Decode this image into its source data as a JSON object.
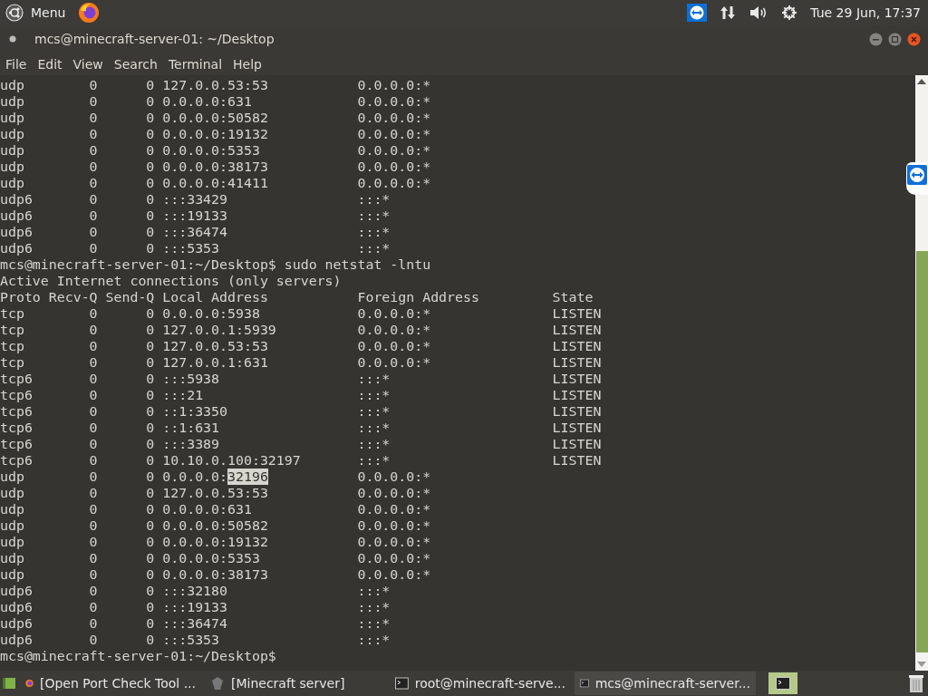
{
  "top_panel": {
    "menu_label": "Menu",
    "clock": "Tue 29 Jun, 17:37"
  },
  "window": {
    "title": "mcs@minecraft-server-01: ~/Desktop"
  },
  "menu": [
    "File",
    "Edit",
    "View",
    "Search",
    "Terminal",
    "Help"
  ],
  "terminal_lines": [
    "udp        0      0 127.0.0.53:53           0.0.0.0:*",
    "udp        0      0 0.0.0.0:631             0.0.0.0:*",
    "udp        0      0 0.0.0.0:50582           0.0.0.0:*",
    "udp        0      0 0.0.0.0:19132           0.0.0.0:*",
    "udp        0      0 0.0.0.0:5353            0.0.0.0:*",
    "udp        0      0 0.0.0.0:38173           0.0.0.0:*",
    "udp        0      0 0.0.0.0:41411           0.0.0.0:*",
    "udp6       0      0 :::33429                :::*",
    "udp6       0      0 :::19133                :::*",
    "udp6       0      0 :::36474                :::*",
    "udp6       0      0 :::5353                 :::*",
    "mcs@minecraft-server-01:~/Desktop$ sudo netstat -lntu",
    "Active Internet connections (only servers)",
    "Proto Recv-Q Send-Q Local Address           Foreign Address         State",
    "tcp        0      0 0.0.0.0:5938            0.0.0.0:*               LISTEN",
    "tcp        0      0 127.0.0.1:5939          0.0.0.0:*               LISTEN",
    "tcp        0      0 127.0.0.53:53           0.0.0.0:*               LISTEN",
    "tcp        0      0 127.0.0.1:631           0.0.0.0:*               LISTEN",
    "tcp6       0      0 :::5938                 :::*                    LISTEN",
    "tcp6       0      0 :::21                   :::*                    LISTEN",
    "tcp6       0      0 ::1:3350                :::*                    LISTEN",
    "tcp6       0      0 ::1:631                 :::*                    LISTEN",
    "tcp6       0      0 :::3389                 :::*                    LISTEN",
    "tcp6       0      0 10.10.0.100:32197       :::*                    LISTEN",
    [
      {
        "text": "udp        0      0 0.0.0.0:",
        "selected": false
      },
      {
        "text": "32196",
        "selected": true
      },
      {
        "text": "           0.0.0.0:*",
        "selected": false
      }
    ],
    "udp        0      0 127.0.0.53:53           0.0.0.0:*",
    "udp        0      0 0.0.0.0:631             0.0.0.0:*",
    "udp        0      0 0.0.0.0:50582           0.0.0.0:*",
    "udp        0      0 0.0.0.0:19132           0.0.0.0:*",
    "udp        0      0 0.0.0.0:5353            0.0.0.0:*",
    "udp        0      0 0.0.0.0:38173           0.0.0.0:*",
    "udp6       0      0 :::32180                :::*",
    "udp6       0      0 :::19133                :::*",
    "udp6       0      0 :::36474                :::*",
    "udp6       0      0 :::5353                 :::*",
    "mcs@minecraft-server-01:~/Desktop$"
  ],
  "taskbar": [
    {
      "kind": "browser",
      "label": "[Open Port Check Tool ...",
      "selected": false
    },
    {
      "kind": "app",
      "label": "[Minecraft server]",
      "selected": false
    },
    {
      "kind": "terminal",
      "label": "root@minecraft-serve...",
      "selected": false
    },
    {
      "kind": "terminal",
      "label": "mcs@minecraft-server...",
      "selected": true
    }
  ]
}
